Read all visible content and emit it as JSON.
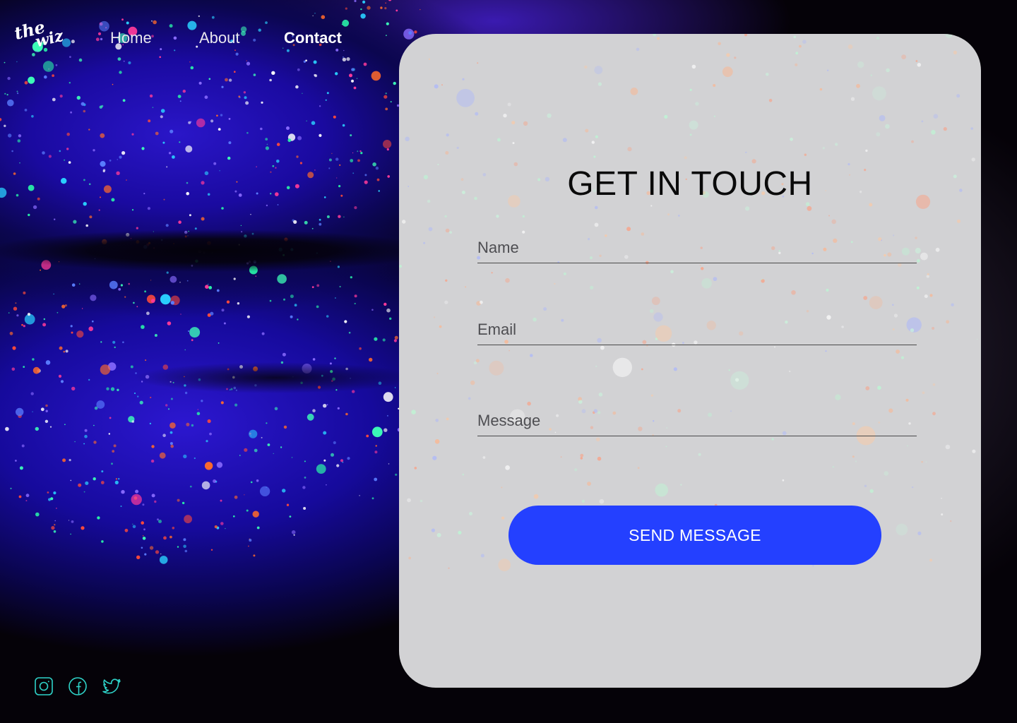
{
  "brand": {
    "logo_line1": "the",
    "logo_line2": "wiz"
  },
  "nav": {
    "items": [
      {
        "label": "Home",
        "active": false
      },
      {
        "label": "About",
        "active": false
      },
      {
        "label": "Contact",
        "active": true
      }
    ]
  },
  "form": {
    "title": "GET IN TOUCH",
    "name_placeholder": "Name",
    "email_placeholder": "Email",
    "message_placeholder": "Message",
    "submit_label": "SEND MESSAGE"
  },
  "social": [
    "instagram-icon",
    "facebook-icon",
    "twitter-icon"
  ],
  "colors": {
    "accent": "#2440ff",
    "card": "#d2d2d4",
    "social_icon": "#2ed3c9",
    "background": "#050208"
  }
}
